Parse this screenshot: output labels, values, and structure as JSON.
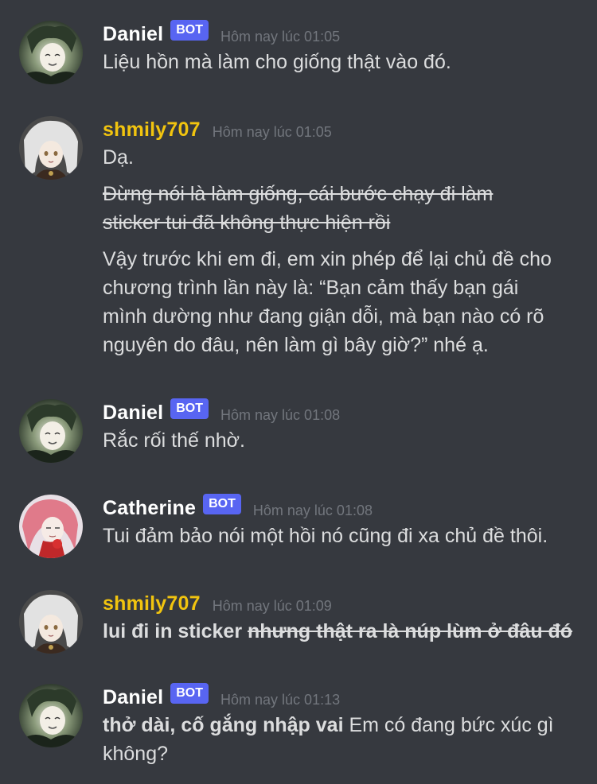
{
  "colors": {
    "background": "#36393f",
    "bot_badge": "#5865f2",
    "text": "#dcddde",
    "timestamp": "#72767d",
    "name_white": "#ffffff",
    "name_yellow": "#f1c40f"
  },
  "messages": [
    {
      "author": "Daniel",
      "bot": true,
      "bot_label": "BOT",
      "timestamp": "Hôm nay lúc 01:05",
      "text": "Liệu hồn mà làm cho giống thật vào đó."
    },
    {
      "author": "shmily707",
      "bot": false,
      "timestamp": "Hôm nay lúc 01:05",
      "line1": "Dạ.",
      "strike_line1": "Đừng nói là làm giống, cái bước chạy đi làm",
      "strike_line2": "sticker tui đã không thực hiện rồi",
      "para_line1": "Vậy trước khi em đi, em xin phép để lại chủ đề cho",
      "para_line2": "chương trình lần này là: “Bạn cảm thấy bạn gái",
      "para_line3": "mình dường như đang giận dỗi, mà bạn nào có rõ",
      "para_line4": "nguyên do đâu, nên làm gì bây giờ?” nhé ạ."
    },
    {
      "author": "Daniel",
      "bot": true,
      "bot_label": "BOT",
      "timestamp": "Hôm nay lúc 01:08",
      "text": "Rắc rối thế nhờ."
    },
    {
      "author": "Catherine",
      "bot": true,
      "bot_label": "BOT",
      "timestamp": "Hôm nay lúc 01:08",
      "text": "Tui đảm bảo nói một hồi nó cũng đi xa chủ đề thôi."
    },
    {
      "author": "shmily707",
      "bot": false,
      "timestamp": "Hôm nay lúc 01:09",
      "bold_text": "lui đi in sticker ",
      "bold_strike_text": "nhưng thật ra là núp lùm ở đâu đó"
    },
    {
      "author": "Daniel",
      "bot": true,
      "bot_label": "BOT",
      "timestamp": "Hôm nay lúc 01:13",
      "bold_text": "thở dài, cố gắng nhập vai",
      "text_line1": " Em có đang bức xúc gì",
      "text_line2": "không?"
    }
  ]
}
